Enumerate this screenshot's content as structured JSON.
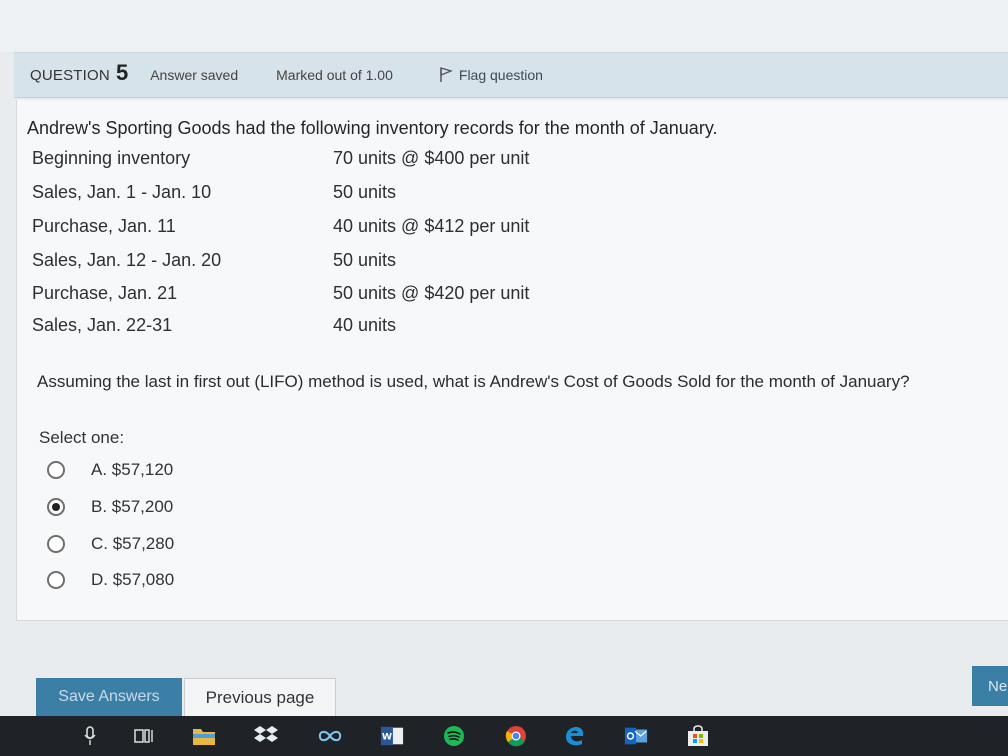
{
  "question": {
    "label": "QUESTION",
    "number": "5",
    "state": "Answer saved",
    "grade": "Marked out of 1.00",
    "flag": "Flag question"
  },
  "intro": "Andrew's Sporting Goods had the following inventory records for the month of January.",
  "inventory": [
    {
      "label": "Beginning inventory",
      "value": "70 units @ $400 per unit"
    },
    {
      "label": "Sales, Jan. 1 - Jan. 10",
      "value": "50 units"
    },
    {
      "label": "Purchase, Jan. 11",
      "value": "40 units @ $412 per unit"
    },
    {
      "label": "Sales, Jan. 12 - Jan. 20",
      "value": "50 units"
    },
    {
      "label": "Purchase, Jan. 21",
      "value": "50 units @ $420 per unit"
    },
    {
      "label": "Sales, Jan. 22-31",
      "value": "40 units"
    }
  ],
  "prompt": "Assuming the last in first out (LIFO) method is used, what is Andrew's Cost of Goods Sold for the month of January?",
  "select_one": "Select one:",
  "options": [
    {
      "text": "A. $57,120",
      "selected": false
    },
    {
      "text": "B. $57,200",
      "selected": true
    },
    {
      "text": "C. $57,280",
      "selected": false
    },
    {
      "text": "D. $57,080",
      "selected": false
    }
  ],
  "buttons": {
    "save": "Save Answers",
    "previous": "Previous page",
    "next": "Ne"
  },
  "taskbar": {
    "icons": [
      "microphone-icon",
      "task-view-icon",
      "file-explorer-icon",
      "dropbox-icon",
      "infinity-app-icon",
      "word-icon",
      "spotify-icon",
      "chrome-icon",
      "edge-icon",
      "outlook-icon",
      "store-icon"
    ]
  },
  "colors": {
    "header_bg": "#d7e3ea",
    "save_button": "#3b7fa6",
    "taskbar": "#1f2328"
  }
}
